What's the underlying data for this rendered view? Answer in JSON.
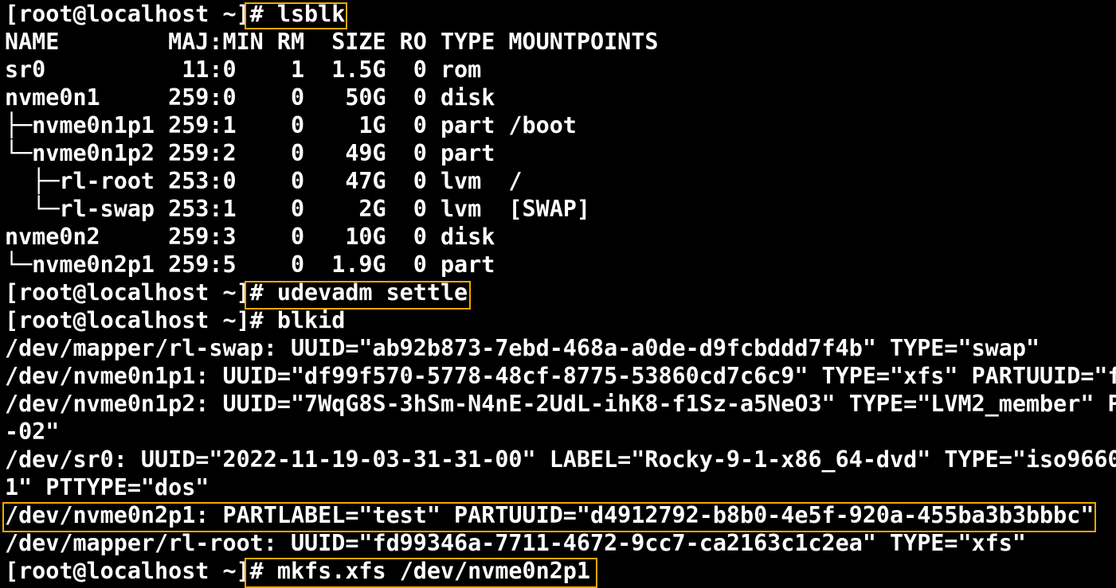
{
  "terminal": {
    "prompt": "[root@localhost ~]",
    "highlight_color": "#f5a800",
    "lines": [
      "[root@localhost ~]# lsblk",
      "NAME        MAJ:MIN RM  SIZE RO TYPE MOUNTPOINTS",
      "sr0          11:0    1  1.5G  0 rom",
      "nvme0n1     259:0    0   50G  0 disk",
      "├─nvme0n1p1 259:1    0    1G  0 part /boot",
      "└─nvme0n1p2 259:2    0   49G  0 part",
      "  ├─rl-root 253:0    0   47G  0 lvm  /",
      "  └─rl-swap 253:1    0    2G  0 lvm  [SWAP]",
      "nvme0n2     259:3    0   10G  0 disk",
      "└─nvme0n2p1 259:5    0  1.9G  0 part",
      "[root@localhost ~]# udevadm settle",
      "[root@localhost ~]# blkid",
      "/dev/mapper/rl-swap: UUID=\"ab92b873-7ebd-468a-a0de-d9fcbddd7f4b\" TYPE=\"swap\"",
      "/dev/nvme0n1p1: UUID=\"df99f570-5778-48cf-8775-53860cd7c6c9\" TYPE=\"xfs\" PARTUUID=\"f",
      "/dev/nvme0n1p2: UUID=\"7WqG8S-3hSm-N4nE-2UdL-ihK8-f1Sz-a5NeO3\" TYPE=\"LVM2_member\" P",
      "-02\"",
      "/dev/sr0: UUID=\"2022-11-19-03-31-31-00\" LABEL=\"Rocky-9-1-x86_64-dvd\" TYPE=\"iso9660",
      "1\" PTTYPE=\"dos\"",
      "/dev/nvme0n2p1: PARTLABEL=\"test\" PARTUUID=\"d4912792-b8b0-4e5f-920a-455ba3b3bbbc\"",
      "/dev/mapper/rl-root: UUID=\"fd99346a-7711-4672-9cc7-ca2163c1c2ea\" TYPE=\"xfs\"",
      "[root@localhost ~]# mkfs.xfs /dev/nvme0n2p1"
    ]
  }
}
